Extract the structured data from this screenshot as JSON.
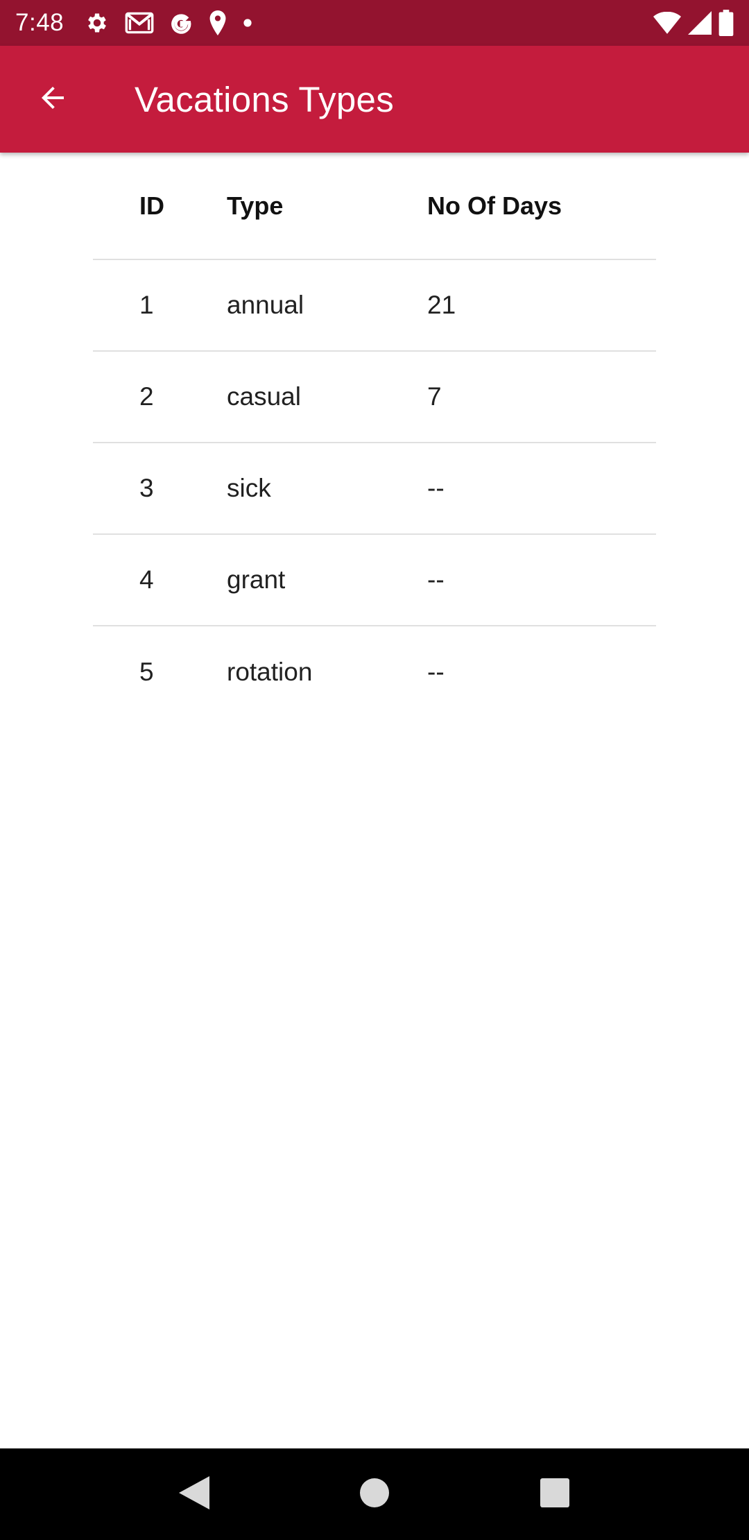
{
  "status_bar": {
    "time": "7:48",
    "left_icons": [
      "settings-icon",
      "gmail-icon",
      "google-icon",
      "location-icon",
      "dot-icon"
    ],
    "right_icons": [
      "wifi-icon",
      "cellular-signal-icon",
      "battery-icon"
    ]
  },
  "app_bar": {
    "title": "Vacations Types",
    "background_color": "#c41c3d",
    "status_bar_color": "#93132f"
  },
  "table": {
    "columns": [
      "ID",
      "Type",
      "No Of Days"
    ],
    "rows": [
      [
        "1",
        "annual",
        "21"
      ],
      [
        "2",
        "casual",
        "7"
      ],
      [
        "3",
        "sick",
        "--"
      ],
      [
        "4",
        "grant",
        "--"
      ],
      [
        "5",
        "rotation",
        "--"
      ]
    ]
  },
  "nav_bar": {
    "buttons": [
      "back-triangle-icon",
      "home-circle-icon",
      "recents-square-icon"
    ]
  }
}
